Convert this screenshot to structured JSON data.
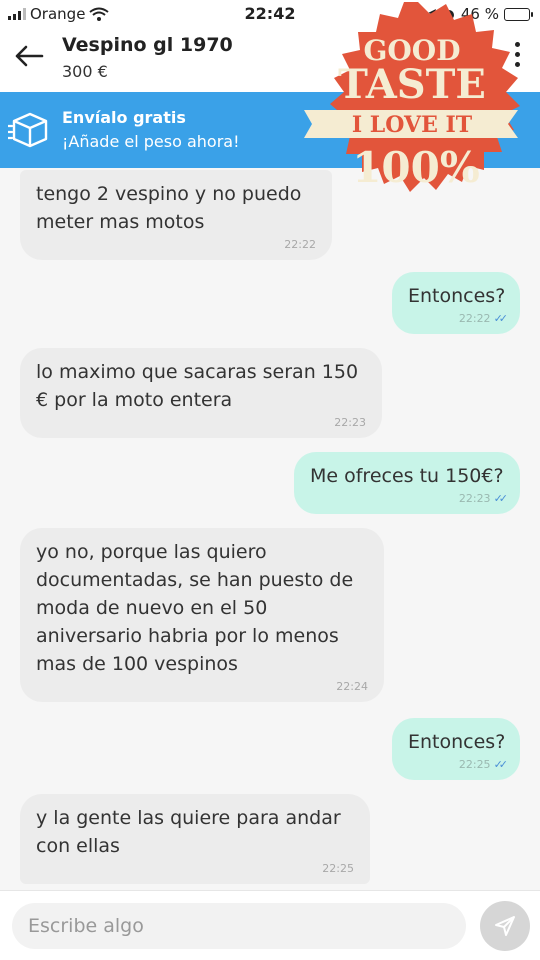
{
  "status": {
    "carrier": "Orange",
    "time": "22:42",
    "battery": "46 %",
    "battery_level": 0.46
  },
  "header": {
    "title": "Vespino gl 1970",
    "price": "300 €"
  },
  "shipping": {
    "title": "Envíalo gratis",
    "subtitle": "¡Añade el peso ahora!"
  },
  "badge": {
    "line1": "GOOD",
    "line2": "TASTE",
    "line3": "I LOVE IT",
    "line4": "100%"
  },
  "messages": [
    {
      "dir": "in",
      "text": "tengo 2 vespino y no puedo meter mas motos",
      "time": "22:22"
    },
    {
      "dir": "out",
      "text": "Entonces?",
      "time": "22:22"
    },
    {
      "dir": "in",
      "text": "lo maximo que sacaras seran 150 € por la moto entera",
      "time": "22:23"
    },
    {
      "dir": "out",
      "text": "Me ofreces tu 150€?",
      "time": "22:23"
    },
    {
      "dir": "in",
      "text": "yo no, porque las quiero documentadas, se han puesto de moda de nuevo en el 50 aniversario habria por lo menos mas de 100 vespinos",
      "time": "22:24"
    },
    {
      "dir": "out",
      "text": "Entonces?",
      "time": "22:25"
    },
    {
      "dir": "in",
      "text": "y la gente las quiere para andar con ellas",
      "time": "22:25"
    }
  ],
  "composer": {
    "placeholder": "Escribe algo"
  },
  "colors": {
    "accent": "#3aa1e8",
    "outgoing": "#c8f4e8",
    "incoming": "#ececec",
    "badge": "#e2553b",
    "ribbon": "#f5ecd2"
  }
}
